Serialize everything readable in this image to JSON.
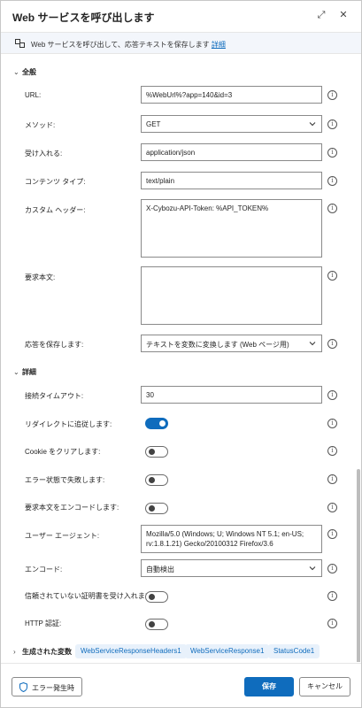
{
  "window": {
    "title": "Web サービスを呼び出します",
    "restore_glyph": "⤢",
    "close_glyph": "✕"
  },
  "info": {
    "text": "Web サービスを呼び出して、応答テキストを保存します",
    "link": "詳細"
  },
  "general": {
    "heading": "全般",
    "url": {
      "label": "URL:",
      "value": "%WebUrl%?app=140&id=3"
    },
    "method": {
      "label": "メソッド:",
      "value": "GET"
    },
    "accept": {
      "label": "受け入れる:",
      "value": "application/json"
    },
    "content_type": {
      "label": "コンテンツ タイプ:",
      "value": "text/plain"
    },
    "custom_headers": {
      "label": "カスタム ヘッダー:",
      "value": "X-Cybozu-API-Token: %API_TOKEN%"
    },
    "request_body": {
      "label": "要求本文:",
      "value": ""
    },
    "save_response": {
      "label": "応答を保存します:",
      "value": "テキストを変数に変換します (Web ページ用)"
    }
  },
  "details": {
    "heading": "詳細",
    "timeout": {
      "label": "接続タイムアウト:",
      "value": "30"
    },
    "follow_redirect": {
      "label": "リダイレクトに追従します:",
      "on": true
    },
    "clear_cookie": {
      "label": "Cookie をクリアします:",
      "on": false
    },
    "fail_on_error": {
      "label": "エラー状態で失敗します:",
      "on": false
    },
    "encode_body": {
      "label": "要求本文をエンコードします:",
      "on": false
    },
    "user_agent": {
      "label": "ユーザー エージェント:",
      "value": "Mozilla/5.0 (Windows; U; Windows NT 5.1; en-US; rv:1.8.1.21) Gecko/20100312 Firefox/3.6"
    },
    "encoding": {
      "label": "エンコード:",
      "value": "自動検出"
    },
    "untrusted_cert": {
      "label": "信頼されていない証明書を受け入れます:",
      "on": false
    },
    "http_auth": {
      "label": "HTTP 認証:",
      "on": false
    }
  },
  "generated": {
    "heading": "生成された変数",
    "variables": [
      "WebServiceResponseHeaders1",
      "WebServiceResponse1",
      "StatusCode1"
    ]
  },
  "footer": {
    "on_error": "エラー発生時",
    "save": "保存",
    "cancel": "キャンセル"
  },
  "colors": {
    "accent": "#0f6cbd",
    "pill_bg": "#e8f1fb"
  }
}
